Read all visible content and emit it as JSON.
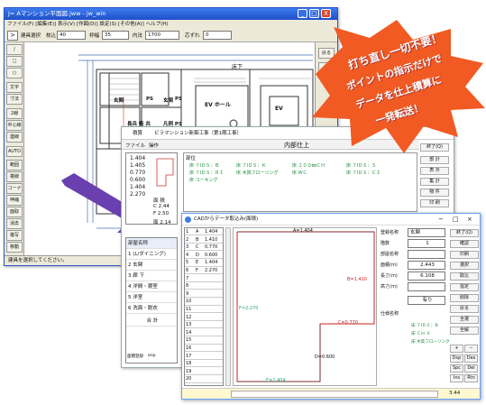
{
  "window1": {
    "title": "J= Aマンション平面図.jww - jw_win",
    "menu": [
      "ファイル(F)",
      "[編集(E)]",
      "表示(V)",
      "[作図(D)]",
      "設定(S)",
      "[その他(A)]",
      "ヘルプ(H)"
    ],
    "toolbar": {
      "mode_button": ">",
      "mode_label": "建具選択",
      "layer_label": "枚込",
      "layer_value": "40",
      "frame_label": "枠幅",
      "frame_value": "35",
      "inner_label": "内法",
      "inner_value": "1700",
      "offset_label": "芯ずれ",
      "offset_value": "0"
    },
    "left_tools": [
      "/",
      "□",
      "○",
      "文字",
      "寸法",
      "2線",
      "中心線",
      "連線",
      "AUTO",
      "範囲",
      "複線",
      "コーナー",
      "伸縮",
      "面取",
      "消去",
      "複写",
      "移動"
    ],
    "right_tools": [
      "戻る",
      "線"
    ],
    "plan_labels": {
      "room_yoka": "床下",
      "room_ev_hall": "EV ホール",
      "ev": "EV",
      "pole_ken": "長兵 衛 共",
      "toilet1": "玄関",
      "toilet2": "玄関",
      "ps1": "PS",
      "ps2": "PS",
      "hanrei": "凡例 PS"
    },
    "status": "建具を選択してください。",
    "controls": {
      "minimize": "_",
      "maximize": "□",
      "close": "X"
    }
  },
  "window2": {
    "title_app": "積算",
    "title_doc": "ビラマンション新築工事（第1期工事）",
    "toolbar_file": "ファイル",
    "toolbar_ops": "操作",
    "section_title": "内部仕上",
    "col_header": "部位",
    "grid_rows": [
      [
        "床 ７ⅠＤＳ：Ｂ",
        "床 ＣＨ-Ｘ",
        "床 ７ⅠＤＳ：ＲＩ",
        "床 木質フローリング",
        "床 ７ⅠＤＳ：Ｋ",
        "床 １００㎜ＣＨ",
        "床 ＷＣ",
        "床 ７ⅠＤＳ：Ｓ",
        "床 ＶＨ",
        "床 ７ⅠＤＳ：ＣＩ"
      ],
      [
        "床 ７ⅠＤＳ：Ｂ"
      ]
    ],
    "grid_labels": [
      "床 ７ⅠＤＳ：Ｂ",
      "床 ７ⅠＤＳ：ＲＩ",
      "床 コーキング",
      "床 ７ⅠＤＳ：Ｋ",
      "床 木質フローリング",
      "床 １００㎜ＣＨ",
      "床 ＷＣ",
      "床 ７ⅠＤＳ：Ｓ",
      "床 ７ⅠＤＳ：ＣＩ"
    ],
    "right_panel": [
      "終了(Q)",
      "部 計",
      "表 示",
      "集 計",
      "物 件",
      "印 刷"
    ],
    "left_values": [
      "1.404",
      "1.405",
      "0.770",
      "0.600",
      "1.404",
      "2.270"
    ],
    "left_caption": [
      "面 積",
      "C 2.44",
      "F 2.50",
      "面 2.14"
    ],
    "room_list_header": "部屋名称",
    "room_list": [
      "1 (L/ダイニング)",
      "2 玄関",
      "3 廊 下",
      "4 洋間・寝室",
      "5 洋室",
      "6 洗面・脱衣"
    ],
    "total_label": "合 計",
    "footer_items": [
      "面積登録",
      "Dsp",
      "部屋毎",
      "部屋名称"
    ]
  },
  "window3": {
    "title": "CADからデータ取込み(面積)",
    "controls": {
      "minimize": "−",
      "maximize": "□",
      "close": "×"
    },
    "rows": [
      [
        "1",
        "A",
        "1.404"
      ],
      [
        "2",
        "B",
        "1.410"
      ],
      [
        "3",
        "C",
        "0.770"
      ],
      [
        "4",
        "D",
        "0.600"
      ],
      [
        "5",
        "E",
        "1.404"
      ],
      [
        "6",
        "F",
        "2.270"
      ],
      [
        "7",
        ""
      ],
      [
        "8",
        ""
      ],
      [
        "9",
        ""
      ],
      [
        "10",
        ""
      ],
      [
        "11",
        ""
      ],
      [
        "12",
        ""
      ],
      [
        "13",
        ""
      ],
      [
        "14",
        ""
      ],
      [
        "15",
        ""
      ],
      [
        "16",
        ""
      ],
      [
        "17",
        ""
      ],
      [
        "18",
        ""
      ],
      [
        "19",
        ""
      ],
      [
        "20",
        ""
      ]
    ],
    "plan_labels": {
      "top": "A=1.404",
      "left": "F=2.270",
      "right": "B=1.410",
      "mid": "C=0.770",
      "bottom": "E=1.404",
      "lower": "D=0.600"
    },
    "form": {
      "name_label": "登録名称",
      "name_value": "玄関",
      "floor_label": "階数",
      "floor_value": "1",
      "room_label": "部屋名称",
      "room_value": "",
      "area_label": "面積(m)",
      "area_value": "2.443",
      "perimeter_label": "長さ(m)",
      "perimeter_value": "6.108",
      "height_label": "高さ(m)",
      "height_value": "",
      "check_label": "有り",
      "finish_label": "仕様名称",
      "finish_items": [
        "床 ７ⅠＤＳ：Ｂ",
        "床 ＣＨ-Ｘ",
        "床 木質フローリング"
      ]
    },
    "buttons": [
      "終了(Q)",
      "確認",
      "印刷",
      "選択",
      "取込",
      "指定",
      "削除",
      "戻る",
      "全選",
      "全解"
    ],
    "bottom_buttons": [
      "+",
      "−",
      "Dsp",
      "Des",
      "Spc",
      "Del",
      "Ins",
      "Rtn"
    ],
    "status_value": "3.44"
  },
  "banner": {
    "lines": [
      "打ち直し一切不要！",
      "ポイントの指示だけで",
      "データを仕上積算に",
      "一発転送！"
    ],
    "color": "#f15a22"
  },
  "arrow_color": "#6a3fb0"
}
